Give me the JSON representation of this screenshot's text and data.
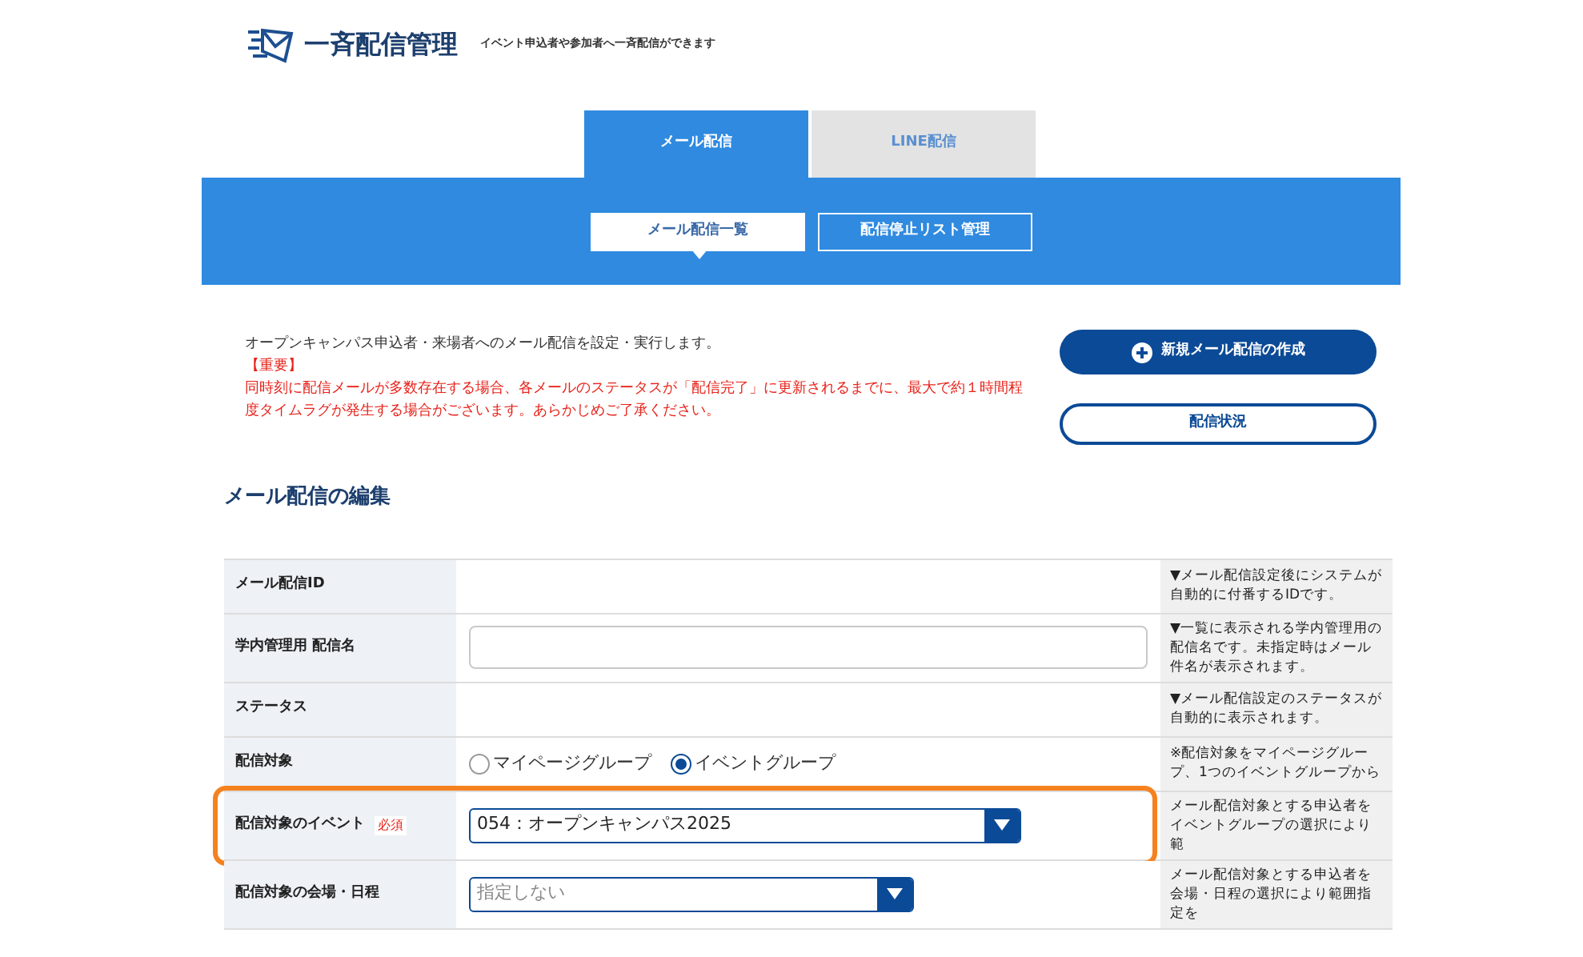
{
  "header": {
    "title": "一斉配信管理",
    "subtitle": "イベント申込者や参加者へ一斉配信ができます"
  },
  "tabs": [
    {
      "label": "メール配信",
      "selected": true
    },
    {
      "label": "LINE配信",
      "selected": false
    }
  ],
  "subtabs": [
    {
      "label": "メール配信一覧",
      "selected": true
    },
    {
      "label": "配信停止リスト管理",
      "selected": false
    }
  ],
  "intro": {
    "description": "オープンキャンパス申込者・来場者へのメール配信を設定・実行します。",
    "notice_title": "【重要】",
    "notice": "同時刻に配信メールが多数存在する場合、各メールのステータスが「配信完了」に更新されるまでに、最大で約１時間程度タイムラグが発生する場合がございます。あらかじめご了承ください。"
  },
  "actions": [
    {
      "kind": "primary",
      "label": "新規メール配信の作成"
    },
    {
      "kind": "outline",
      "label": "配信状況"
    }
  ],
  "section_title": "メール配信の編集",
  "form_rows": [
    {
      "kind": "empty",
      "label": "メール配信ID",
      "note": "▼メール配信設定後にシステムが自動的に付番するIDです。"
    },
    {
      "kind": "text",
      "label": "学内管理用 配信名",
      "note": "▼一覧に表示される学内管理用の配信名です。未指定時はメール件名が表示されます。"
    },
    {
      "kind": "empty",
      "label": "ステータス",
      "note": "▼メール配信設定のステータスが自動的に表示されます。"
    },
    {
      "kind": "radio",
      "label": "配信対象",
      "options": [
        {
          "label": "マイページグループ",
          "selected": false
        },
        {
          "label": "イベントグループ",
          "selected": true
        }
      ],
      "note": "※配信対象をマイページグループ、1つのイベントグループから"
    },
    {
      "kind": "select",
      "label": "配信対象のイベント",
      "required_label": "必須",
      "highlighted": true,
      "value": "054：オープンキャンパス2025",
      "note": "メール配信対象とする申込者をイベントグループの選択により範"
    },
    {
      "kind": "select",
      "label": "配信対象の会場・日程",
      "placeholder": "指定しない",
      "note": "メール配信対象とする申込者を会場・日程の選択により範囲指定を"
    }
  ]
}
